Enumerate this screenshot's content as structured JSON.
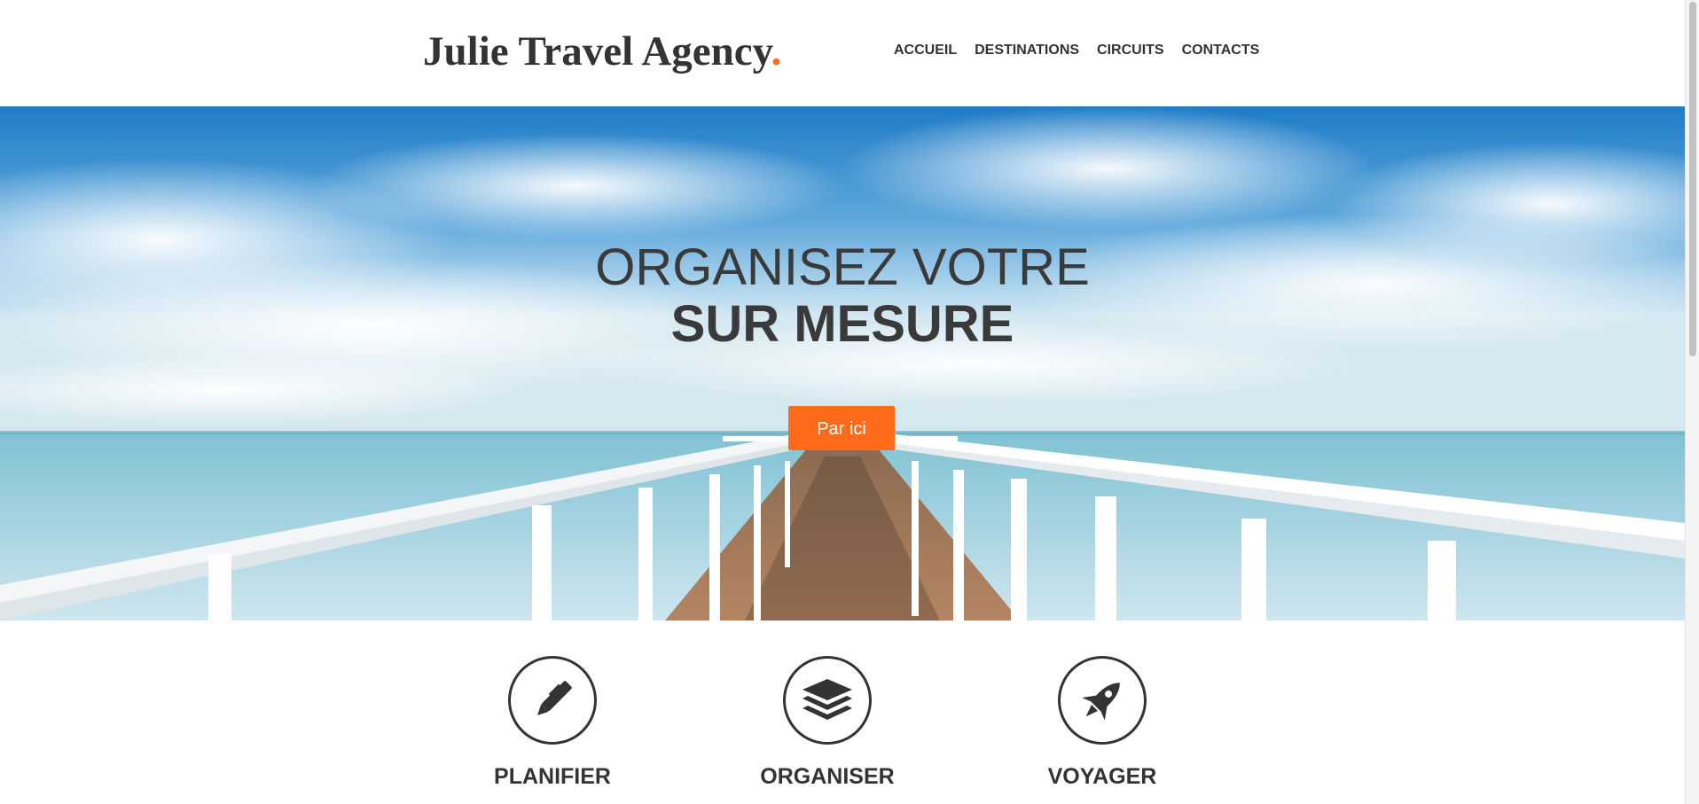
{
  "header": {
    "logo_text": "Julie Travel Agency",
    "logo_dot": ".",
    "nav": [
      {
        "label": "ACCUEIL"
      },
      {
        "label": "DESTINATIONS"
      },
      {
        "label": "CIRCUITS"
      },
      {
        "label": "CONTACTS"
      }
    ]
  },
  "hero": {
    "title_line1": "ORGANISEZ VOTRE",
    "title_line2": "SUR MESURE",
    "cta_label": "Par ici"
  },
  "features": [
    {
      "label": "PLANIFIER",
      "icon": "pen-icon"
    },
    {
      "label": "ORGANISER",
      "icon": "layers-icon"
    },
    {
      "label": "VOYAGER",
      "icon": "rocket-icon"
    }
  ],
  "colors": {
    "accent": "#ff6b1a",
    "text": "#333333"
  }
}
